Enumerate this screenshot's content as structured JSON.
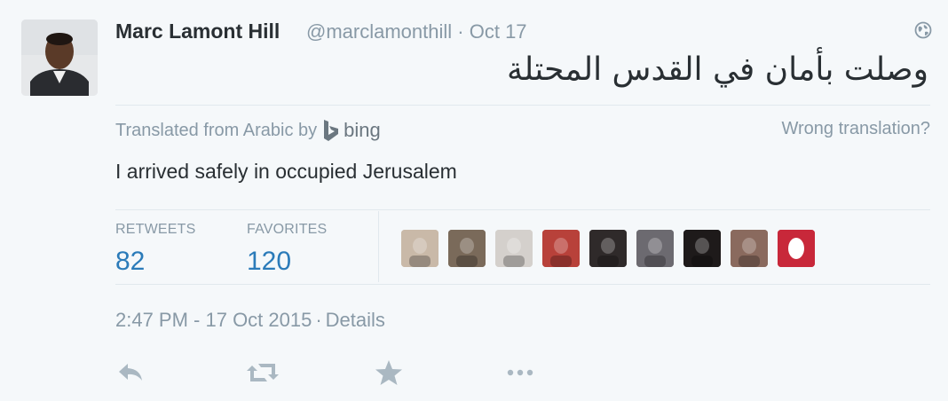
{
  "user": {
    "name": "Marc Lamont Hill",
    "handle": "@marclamonthill",
    "separator": "·",
    "date": "Oct 17"
  },
  "tweet": {
    "text_arabic": "وصلت بأمان في القدس المحتلة",
    "translation_prefix": "Translated from Arabic by",
    "translation_provider": "bing",
    "wrong_translation": "Wrong translation?",
    "translation": "I arrived safely in occupied Jerusalem"
  },
  "stats": {
    "retweets_label": "RETWEETS",
    "retweets_count": "82",
    "favorites_label": "FAVORITES",
    "favorites_count": "120"
  },
  "favoriters": [
    {
      "name": "favoriter-avatar-1",
      "color": "#c9b9a8"
    },
    {
      "name": "favoriter-avatar-2",
      "color": "#7a6a5a"
    },
    {
      "name": "favoriter-avatar-3",
      "color": "#d4d0cc"
    },
    {
      "name": "favoriter-avatar-4",
      "color": "#b8413a"
    },
    {
      "name": "favoriter-avatar-5",
      "color": "#2f2a2a"
    },
    {
      "name": "favoriter-avatar-6",
      "color": "#6c6a70"
    },
    {
      "name": "favoriter-avatar-7",
      "color": "#1e1a1a"
    },
    {
      "name": "favoriter-avatar-8",
      "color": "#8a6a5e"
    },
    {
      "name": "favoriter-avatar-9",
      "color": "#c8283a"
    }
  ],
  "meta": {
    "time": "2:47 PM - 17 Oct 2015",
    "separator": "·",
    "details": "Details"
  },
  "icons": {
    "reply": "reply-icon",
    "retweet": "retweet-icon",
    "favorite": "star-icon",
    "more": "more-icon",
    "globe": "globe-icon"
  },
  "colors": {
    "background": "#f5f8fa",
    "text": "#292f33",
    "muted": "#8899a6",
    "link": "#2b7bb9",
    "icon": "#aab8c2"
  }
}
